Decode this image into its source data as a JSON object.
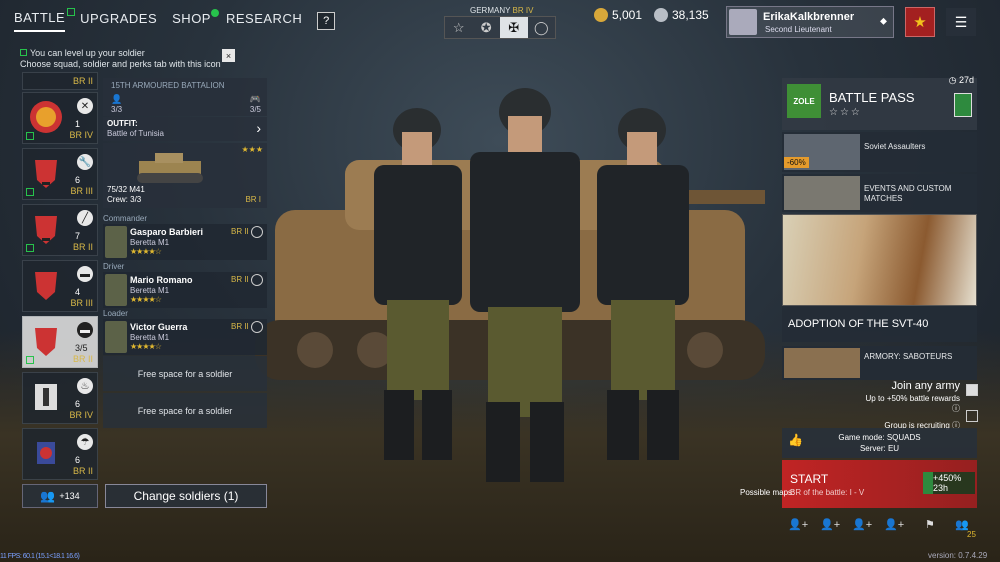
{
  "nav": {
    "tabs": [
      "BATTLE",
      "UPGRADES",
      "SHOP",
      "RESEARCH"
    ],
    "help": "?"
  },
  "notice": {
    "line1": "You can level up your soldier",
    "line2": "Choose squad, soldier and perks tab with this icon",
    "close": "×"
  },
  "squads": [
    {
      "count": "",
      "br": "BR II"
    },
    {
      "count": "1",
      "br": "BR IV"
    },
    {
      "count": "6",
      "br": "BR III"
    },
    {
      "count": "7",
      "br": "BR II"
    },
    {
      "count": "4",
      "br": "BR III"
    },
    {
      "count": "3/5",
      "br": "BR II"
    },
    {
      "count": "6",
      "br": "BR IV"
    },
    {
      "count": "6",
      "br": "BR II"
    }
  ],
  "squad_detail": {
    "battalion": "15TH ARMOURED BATTALION",
    "left_count": "3/3",
    "right_count": "3/5",
    "outfit_label": "OUTFIT:",
    "outfit_value": "Battle of Tunisia",
    "vehicle_name": "75/32 M41",
    "vehicle_crew": "Crew: 3/3",
    "vehicle_br": "BR I",
    "vehicle_stars": "★★★"
  },
  "soldiers": [
    {
      "role": "Commander",
      "name": "Gasparo Barbieri",
      "weapon": "Beretta M1",
      "br": "BR II",
      "stars": "★★★★☆"
    },
    {
      "role": "Driver",
      "name": "Mario Romano",
      "weapon": "Beretta M1",
      "br": "BR II",
      "stars": "★★★★☆"
    },
    {
      "role": "Loader",
      "name": "Victor Guerra",
      "weapon": "Beretta M1",
      "br": "BR II",
      "stars": "★★★★☆"
    }
  ],
  "free_slots": [
    "Free space for a soldier",
    "Free space for a soldier"
  ],
  "bottom_left": {
    "rank_count": "+134",
    "change_soldiers": "Change soldiers (1)"
  },
  "army": {
    "nation": "GERMANY",
    "br": "BR IV"
  },
  "currency": {
    "gold": "5,001",
    "silver": "38,135"
  },
  "profile": {
    "name": "ErikaKalkbrenner",
    "rank": "Second Lieutenant"
  },
  "battle_pass": {
    "title": "BATTLE PASS",
    "stars": "☆☆☆",
    "days": "27d",
    "logo": "ZOLE"
  },
  "events": [
    {
      "title": "Soviet Assaulters",
      "badge": "-60%"
    },
    {
      "title": "EVENTS AND CUSTOM MATCHES",
      "badge": ""
    }
  ],
  "feature": {
    "title": "ADOPTION OF THE SVT-40",
    "armory": "ARMORY: SABOTEURS"
  },
  "join": {
    "title": "Join any army",
    "reward": "Up to +50% battle rewards",
    "recruiting": "Group is recruiting"
  },
  "mode": {
    "line1": "Game mode: SQUADS",
    "line2": "Server: EU"
  },
  "start": {
    "title": "START",
    "subtitle": "BR of the battle: I - V",
    "xp": "+450% 23h"
  },
  "maps_label": "Possible maps:",
  "party_count": "25",
  "version": "version: 0.7.4.29",
  "fps": "11 FPS: 60.1 (15.1<18.1 16.6)",
  "colors": {
    "accent_green": "#27c24c",
    "br_gold": "#d8b848",
    "start_red": "#c02424"
  }
}
